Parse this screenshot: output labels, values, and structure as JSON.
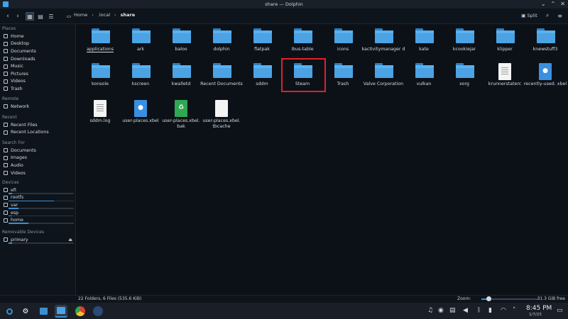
{
  "window": {
    "title": "share — Dolphin"
  },
  "toolbar": {
    "back_glyph": "‹",
    "forward_glyph": "›",
    "breadcrumbs": [
      "Home",
      ".local",
      "share"
    ],
    "split_label": "Split"
  },
  "sidebar": {
    "sections": [
      {
        "heading": "Places",
        "items": [
          {
            "label": "Home",
            "icon": "home-icon"
          },
          {
            "label": "Desktop",
            "icon": "desktop-icon"
          },
          {
            "label": "Documents",
            "icon": "documents-icon"
          },
          {
            "label": "Downloads",
            "icon": "downloads-icon"
          },
          {
            "label": "Music",
            "icon": "music-icon"
          },
          {
            "label": "Pictures",
            "icon": "pictures-icon"
          },
          {
            "label": "Videos",
            "icon": "videos-icon"
          },
          {
            "label": "Trash",
            "icon": "trash-icon"
          }
        ]
      },
      {
        "heading": "Remote",
        "items": [
          {
            "label": "Network",
            "icon": "network-icon"
          }
        ]
      },
      {
        "heading": "Recent",
        "items": [
          {
            "label": "Recent Files",
            "icon": "recent-files-icon"
          },
          {
            "label": "Recent Locations",
            "icon": "recent-locations-icon"
          }
        ]
      },
      {
        "heading": "Search For",
        "items": [
          {
            "label": "Documents",
            "icon": "documents-icon"
          },
          {
            "label": "Images",
            "icon": "images-icon"
          },
          {
            "label": "Audio",
            "icon": "audio-icon"
          },
          {
            "label": "Videos",
            "icon": "videos-icon"
          }
        ]
      },
      {
        "heading": "Devices",
        "items": [
          {
            "label": "efi",
            "icon": "drive-icon",
            "usage": 0.05
          },
          {
            "label": "rootfs",
            "icon": "drive-icon",
            "usage": 0.7
          },
          {
            "label": "var",
            "icon": "drive-icon",
            "usage": 0.15
          },
          {
            "label": "esp",
            "icon": "drive-icon",
            "usage": 0.05
          },
          {
            "label": "home",
            "icon": "drive-icon",
            "usage": 0.3
          }
        ]
      },
      {
        "heading": "Removable Devices",
        "items": [
          {
            "label": "primary",
            "icon": "drive-icon",
            "usage": 0.05,
            "eject": "⏏"
          }
        ]
      }
    ]
  },
  "files": {
    "items": [
      {
        "name": "applications",
        "type": "folder"
      },
      {
        "name": "ark",
        "type": "folder"
      },
      {
        "name": "baloo",
        "type": "folder"
      },
      {
        "name": "dolphin",
        "type": "folder"
      },
      {
        "name": "flatpak",
        "type": "folder"
      },
      {
        "name": "ibus-table",
        "type": "folder"
      },
      {
        "name": "icons",
        "type": "folder"
      },
      {
        "name": "kactivitymanager d",
        "type": "folder"
      },
      {
        "name": "kate",
        "type": "folder"
      },
      {
        "name": "kcookiejar",
        "type": "folder"
      },
      {
        "name": "klipper",
        "type": "folder"
      },
      {
        "name": "knewstuff3",
        "type": "folder"
      },
      {
        "name": "konsole",
        "type": "folder"
      },
      {
        "name": "kscreen",
        "type": "folder"
      },
      {
        "name": "kwalletd",
        "type": "folder"
      },
      {
        "name": "Recent Documents",
        "type": "folder"
      },
      {
        "name": "sddm",
        "type": "folder"
      },
      {
        "name": "Steam",
        "type": "folder"
      },
      {
        "name": "Trash",
        "type": "folder"
      },
      {
        "name": "Valve Corporation",
        "type": "folder"
      },
      {
        "name": "vulkan",
        "type": "folder"
      },
      {
        "name": "xorg",
        "type": "folder"
      },
      {
        "name": "krunnerstaterc",
        "type": "text"
      },
      {
        "name": "recently-used. xbel",
        "type": "xbel"
      },
      {
        "name": "sddm.log",
        "type": "text"
      },
      {
        "name": "user-places.xbel",
        "type": "xbel"
      },
      {
        "name": "user-places.xbel. bak",
        "type": "bak"
      },
      {
        "name": "user-places.xbel. tbcache",
        "type": "blank"
      }
    ]
  },
  "status": {
    "summary": "22 Folders, 6 Files (535.6 KiB)",
    "zoom_label": "Zoom:",
    "zoom_level": 0.12,
    "free_space": "31.3 GiB free"
  },
  "taskbar": {
    "time": "8:45 PM",
    "date": "1/7/23"
  },
  "colors": {
    "accent": "#3b8fd1",
    "folder": "#4ba3e3",
    "highlight": "#e0202a"
  }
}
